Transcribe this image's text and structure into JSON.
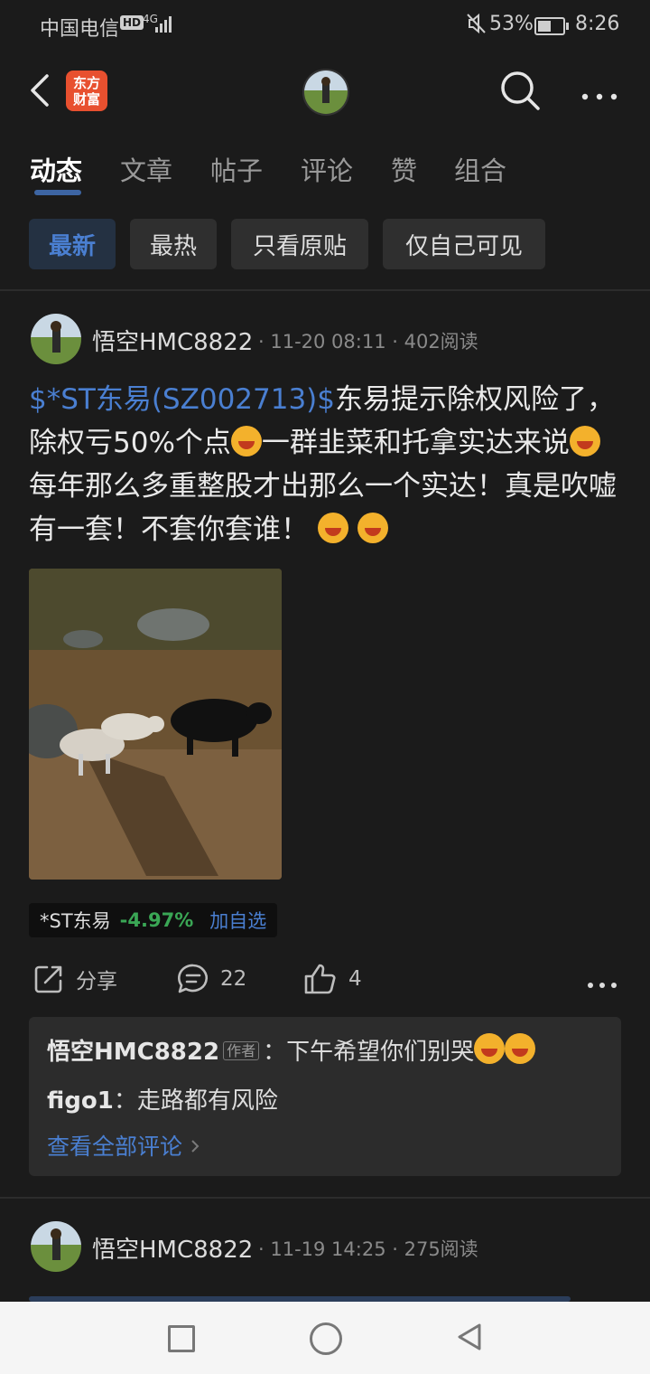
{
  "status_bar": {
    "carrier": "中国电信",
    "hd": "HD",
    "network": "4G",
    "battery": "53%",
    "battery_level": 0.53,
    "time": "8:26"
  },
  "header": {
    "logo_line1": "东方",
    "logo_line2": "财富"
  },
  "tabs": [
    {
      "label": "动态",
      "active": true
    },
    {
      "label": "文章",
      "active": false
    },
    {
      "label": "帖子",
      "active": false
    },
    {
      "label": "评论",
      "active": false
    },
    {
      "label": "赞",
      "active": false
    },
    {
      "label": "组合",
      "active": false
    }
  ],
  "filters": [
    {
      "label": "最新",
      "active": true
    },
    {
      "label": "最热",
      "active": false
    },
    {
      "label": "只看原贴",
      "active": false
    },
    {
      "label": "仅自己可见",
      "active": false
    }
  ],
  "post1": {
    "username": "悟空HMC8822",
    "meta": "· 11-20 08:11 · 402阅读",
    "stock_link": "$*ST东易(SZ002713)$",
    "text_a": "东易提示除权风险了，除权亏50%个点",
    "text_b": "一群韭菜和托拿实达来说",
    "text_c": "每年那么多重整股才出那么一个实达！真是吹嘘有一套！不套你套谁！",
    "stock_tag": {
      "name": "*ST东易",
      "change": "-4.97%",
      "add": "加自选"
    },
    "actions": {
      "share": "分享",
      "comments": "22",
      "likes": "4"
    },
    "comments": [
      {
        "author": "悟空HMC8822",
        "badge": "作者",
        "sep": "：",
        "text": "下午希望你们别哭"
      },
      {
        "author": "figo1",
        "sep": "：",
        "text": "走路都有风险"
      }
    ],
    "view_all": "查看全部评论"
  },
  "post2": {
    "username": "悟空HMC8822",
    "meta": "· 11-19 14:25 · 275阅读"
  },
  "colors": {
    "accent": "#4a7fd1",
    "negative": "#3aa655",
    "background": "#1b1b1b"
  }
}
